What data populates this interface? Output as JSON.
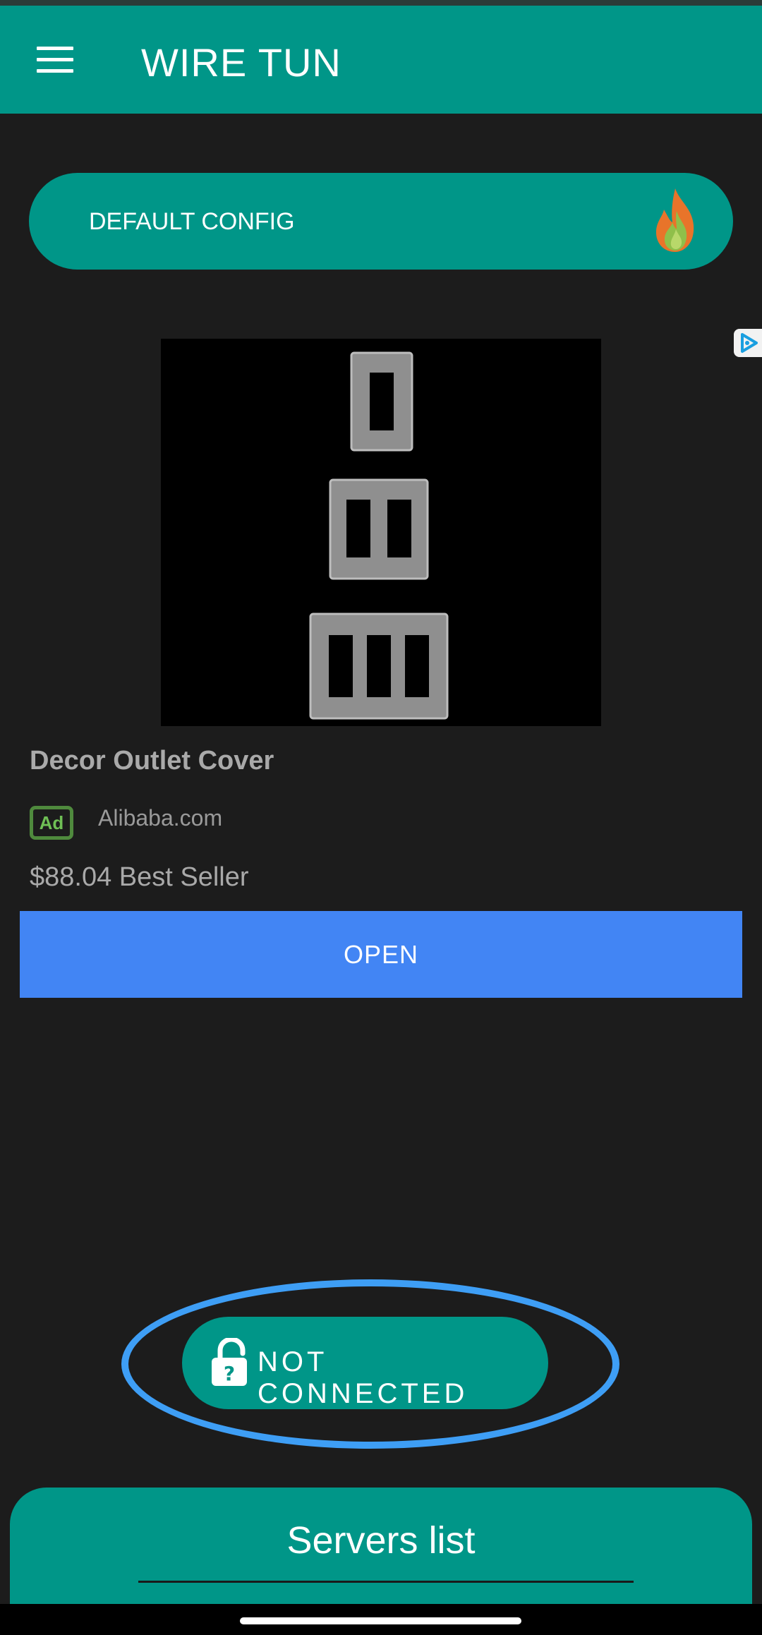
{
  "app_bar": {
    "title": "WIRE TUN",
    "menu_icon": "hamburger-menu-icon"
  },
  "config": {
    "label": "DEFAULT CONFIG",
    "icon": "flame-icon"
  },
  "ad": {
    "adchoices_icon": "adchoices-icon",
    "image": "wall-outlet-covers-image",
    "title": "Decor Outlet Cover",
    "badge": "Ad",
    "source": "Alibaba.com",
    "price": "$88.04 Best Seller",
    "cta": "OPEN",
    "cta_color": "#4285f4"
  },
  "connection": {
    "status": "NOT CONNECTED",
    "icon": "unlocked-padlock-question-icon",
    "highlight_color": "#3e9ef5"
  },
  "servers": {
    "title": "Servers list"
  },
  "colors": {
    "accent": "#009688",
    "background": "#1c1c1c"
  }
}
